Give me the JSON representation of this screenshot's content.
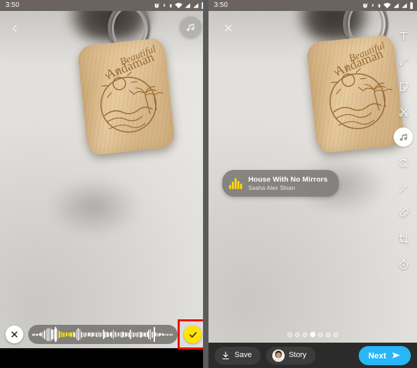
{
  "app": {
    "name": "story-editor",
    "accent_blue": "#29b6f6",
    "accent_yellow": "#ffe400",
    "highlight_red": "#f00000"
  },
  "status_bar": {
    "time": "3:50",
    "icons": [
      "alarm-icon",
      "bluetooth-icon",
      "vibrate-icon",
      "wifi-icon",
      "signal-icon",
      "signal-icon",
      "battery-icon"
    ]
  },
  "left_panel": {
    "name": "music-trim-screen",
    "back_label": "‹",
    "music_button_label": "♫",
    "trim": {
      "cancel_label": "✕",
      "confirm_label": "✓",
      "selection_start_pct": 18,
      "selection_end_pct": 84
    }
  },
  "right_panel": {
    "name": "story-edit-screen",
    "close_label": "✕",
    "toolbar": [
      {
        "id": "text-tool",
        "label": "T",
        "active": false
      },
      {
        "id": "draw-tool",
        "label": "pencil",
        "active": false
      },
      {
        "id": "sticker-tool",
        "label": "sticker",
        "active": false
      },
      {
        "id": "cut-tool",
        "label": "scissors",
        "active": false
      },
      {
        "id": "music-tool",
        "label": "music",
        "active": true
      },
      {
        "id": "magic-eraser-tool",
        "label": "magic-eraser",
        "active": false
      },
      {
        "id": "effects-tool",
        "label": "sparkle-wand",
        "active": false
      },
      {
        "id": "attach-tool",
        "label": "paperclip",
        "active": false
      },
      {
        "id": "crop-tool",
        "label": "crop",
        "active": false
      },
      {
        "id": "timer-tool",
        "label": "timer",
        "active": false
      }
    ],
    "song_card": {
      "title": "House With No Mirrors",
      "artist": "Sasha Alex Sloan"
    },
    "page_dots": {
      "count": 7,
      "active_index": 3
    },
    "actions": {
      "save_label": "Save",
      "story_label": "Story",
      "next_label": "Next"
    }
  },
  "photo": {
    "subject": "wooden keychain with keyring",
    "engraving_line1": "Beautiful",
    "engraving_line2": "Andaman"
  }
}
